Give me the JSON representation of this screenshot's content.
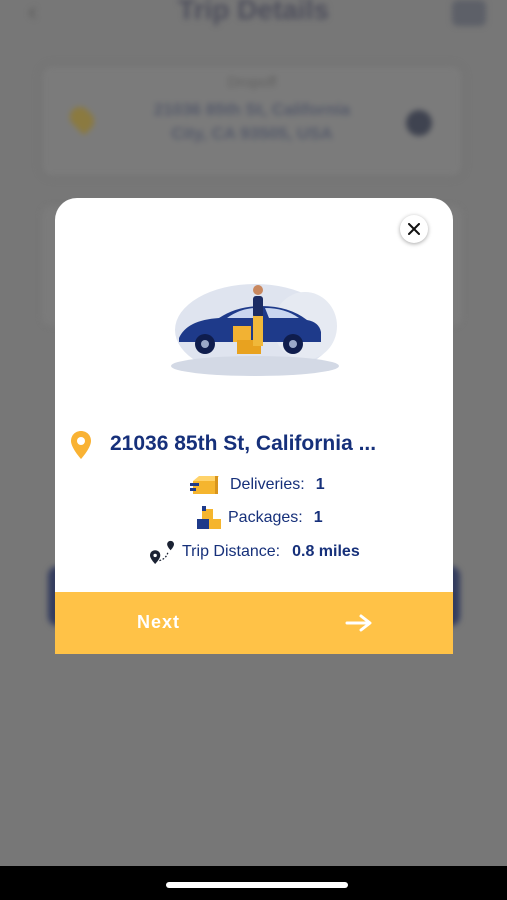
{
  "background_screen": {
    "title": "Trip Details",
    "card_label": "Dropoff",
    "card_line1": "21036 85th St, California",
    "card_line2": "City, CA 93505, USA"
  },
  "modal": {
    "address": "21036 85th St, California ...",
    "stats": [
      {
        "label": "Deliveries:",
        "value": "1",
        "icon": "delivery-box-icon"
      },
      {
        "label": "Packages:",
        "value": "1",
        "icon": "package-stack-icon"
      },
      {
        "label": "Trip Distance:",
        "value": "0.8 miles",
        "icon": "route-icon"
      }
    ],
    "next_button": {
      "label": "Next",
      "icon": "arrow-right-icon"
    },
    "close_icon": "close-icon"
  },
  "colors": {
    "primary_text": "#16307a",
    "accent_yellow": "#ffc247",
    "overlay": "#777777"
  }
}
